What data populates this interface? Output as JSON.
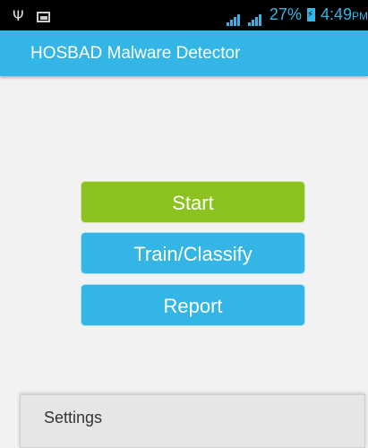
{
  "status_bar": {
    "usb_icon": "usb-icon",
    "image_icon": "image-icon",
    "battery_percent": "27%",
    "time": "4:49",
    "ampm": "PM",
    "accent_color": "#33b5e5"
  },
  "action_bar": {
    "title": "HOSBAD Malware Detector",
    "color": "#33b5e5"
  },
  "buttons": {
    "start": "Start",
    "train_classify": "Train/Classify",
    "report": "Report",
    "start_color": "#8cc21f",
    "secondary_color": "#33b5e5"
  },
  "menu": {
    "settings": "Settings"
  }
}
